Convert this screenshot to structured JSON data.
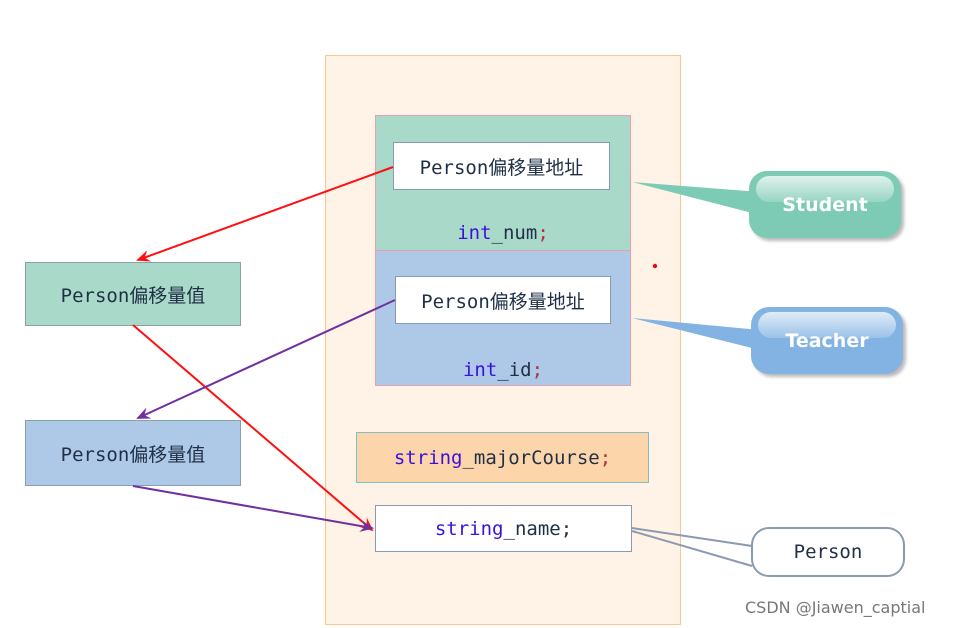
{
  "memory_layout": {
    "student_part": {
      "offset_box": "Person偏移量地址",
      "member_type": "int",
      "member_name": " _num",
      "semicolon": ";"
    },
    "teacher_part": {
      "offset_box": "Person偏移量地址",
      "member_type": "int",
      "member_name": " _id",
      "semicolon": ";"
    },
    "assistant_member": {
      "type": "string",
      "name": " _majorCourse",
      "semicolon": ";"
    },
    "person_member": {
      "type": "string",
      "name": " _name;"
    }
  },
  "offset_tables": [
    {
      "label": "Person偏移量值",
      "color": "#a9d9c9"
    },
    {
      "label": "Person偏移量值",
      "color": "#aec8e8"
    }
  ],
  "callouts": {
    "student": {
      "label": "Student",
      "color": "#7ecbb5"
    },
    "teacher": {
      "label": "Teacher",
      "color": "#82b3e2"
    },
    "person": {
      "label": "Person"
    }
  },
  "arrow_colors": {
    "red": "#ff1010",
    "purple": "#7030a0"
  },
  "watermark": "CSDN @Jiawen_captial"
}
